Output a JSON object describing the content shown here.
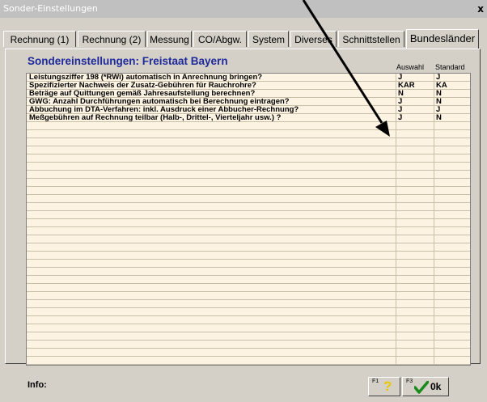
{
  "window": {
    "title": "Sonder-Einstellungen",
    "close_label": "x"
  },
  "tabs": [
    {
      "label": "Rechnung (1)",
      "active": false
    },
    {
      "label": "Rechnung (2)",
      "active": false
    },
    {
      "label": "Messung",
      "active": false
    },
    {
      "label": "CO/Abgw.",
      "active": false
    },
    {
      "label": "System",
      "active": false
    },
    {
      "label": "Diverses",
      "active": false
    },
    {
      "label": "Schnittstellen",
      "active": false
    },
    {
      "label": "Bundesländer",
      "active": true
    }
  ],
  "panel": {
    "heading": "Sondereinstellungen: Freistaat Bayern",
    "columns": {
      "auswahl": "Auswahl",
      "standard": "Standard"
    }
  },
  "rows": [
    {
      "label": "Leistungsziffer 198 (*RWi) automatisch in Anrechnung bringen?",
      "auswahl": "J",
      "standard": "J"
    },
    {
      "label": "Spezifizierter Nachweis der Zusatz-Gebühren für Rauchrohre?",
      "auswahl": "KAR",
      "standard": "KA"
    },
    {
      "label": "Beträge auf Quittungen gemäß Jahresaufstellung berechnen?",
      "auswahl": "N",
      "standard": "N"
    },
    {
      "label": "GWG: Anzahl Durchführungen automatisch bei Berechnung eintragen?",
      "auswahl": "J",
      "standard": "N"
    },
    {
      "label": "Abbuchung im DTA-Verfahren: inkl. Ausdruck einer Abbucher-Rechnung?",
      "auswahl": "J",
      "standard": "J"
    },
    {
      "label": "Meßgebühren auf Rechnung teilbar (Halb-, Drittel-, Vierteljahr usw.) ?",
      "auswahl": "J",
      "standard": "N"
    }
  ],
  "footer": {
    "info_label": "Info:",
    "help_button": {
      "fkey": "F1",
      "icon": "question-mark-icon"
    },
    "ok_button": {
      "fkey": "F3",
      "icon": "checkmark-icon",
      "label": "0k"
    }
  },
  "annotation": {
    "arrow_color": "#000000"
  },
  "colors": {
    "heading": "#1e2a9a",
    "grid_bg": "#fdf3e3",
    "help_icon": "#e8c800",
    "ok_icon": "#1a8a1a"
  }
}
